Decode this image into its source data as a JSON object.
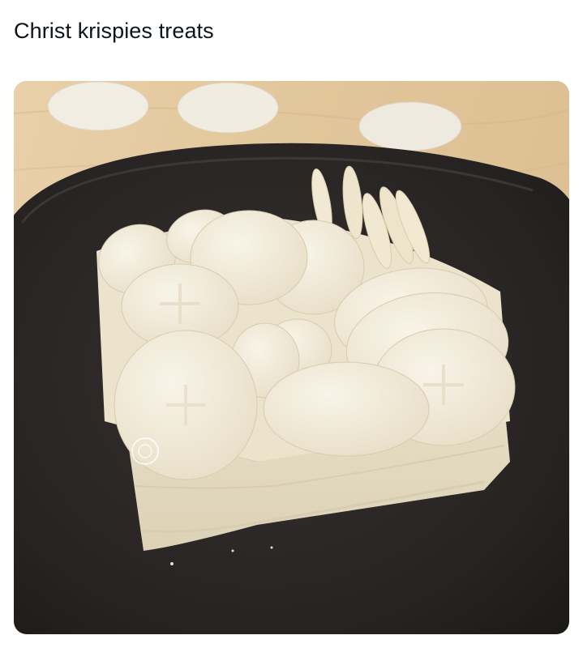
{
  "post": {
    "text": "Christ krispies treats"
  },
  "media": {
    "alt": "Square of rice-krispie style treat covered in round communion wafers on a black plate, more wafers on a wooden table in background",
    "colors": {
      "table": "#e4cba3",
      "plate": "#2a2625",
      "treat": "#eee8d6",
      "wafer": "#f3eddd"
    },
    "watermark_icon": "circle-emblem-icon"
  }
}
